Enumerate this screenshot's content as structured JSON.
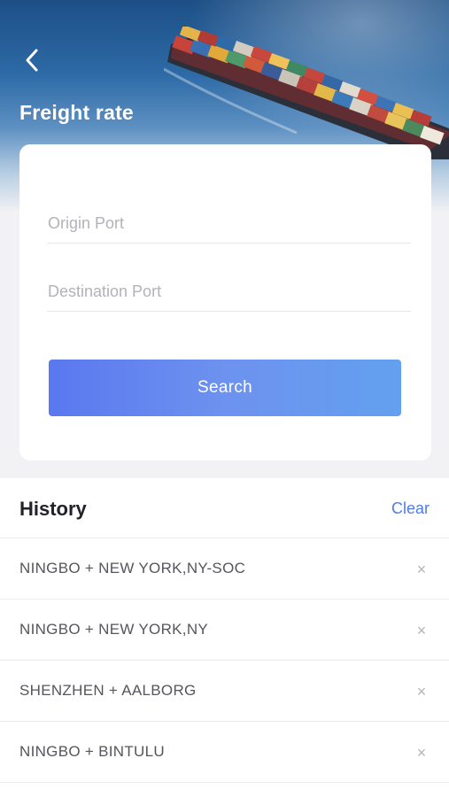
{
  "header": {
    "title": "Freight rate",
    "back_icon": "chevron-left-icon"
  },
  "form": {
    "origin_placeholder": "Origin Port",
    "origin_value": "",
    "destination_placeholder": "Destination Port",
    "destination_value": "",
    "search_label": "Search"
  },
  "history": {
    "title": "History",
    "clear_label": "Clear",
    "remove_icon": "close-icon",
    "remove_glyph": "×",
    "items": [
      {
        "label": "NINGBO + NEW YORK,NY-SOC"
      },
      {
        "label": "NINGBO + NEW YORK,NY"
      },
      {
        "label": "SHENZHEN + AALBORG"
      },
      {
        "label": "NINGBO + BINTULU"
      }
    ]
  },
  "colors": {
    "accent": "#4f7de6",
    "button_gradient_start": "#5a78ef",
    "button_gradient_end": "#63a0ef"
  }
}
